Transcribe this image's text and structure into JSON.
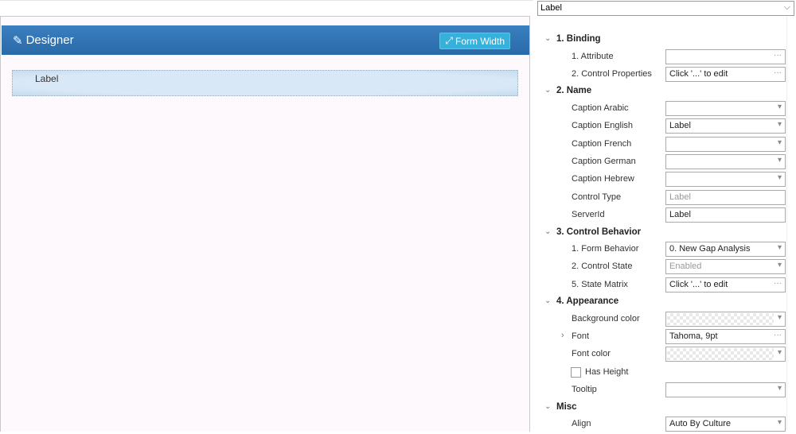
{
  "designer": {
    "title": "Designer",
    "form_width": "Form Width",
    "label_text": "Label"
  },
  "selector": {
    "value": "Label"
  },
  "sections": [
    {
      "title": "1. Binding",
      "rows": [
        {
          "label": "1. Attribute",
          "value": "",
          "kind": "ellipsis"
        },
        {
          "label": "2. Control Properties",
          "value": "Click '...' to edit",
          "kind": "ellipsis"
        }
      ]
    },
    {
      "title": "2. Name",
      "rows": [
        {
          "label": "Caption Arabic",
          "value": "",
          "kind": "dropdown"
        },
        {
          "label": "Caption English",
          "value": "Label",
          "kind": "dropdown"
        },
        {
          "label": "Caption French",
          "value": "",
          "kind": "dropdown"
        },
        {
          "label": "Caption German",
          "value": "",
          "kind": "dropdown"
        },
        {
          "label": "Caption Hebrew",
          "value": "",
          "kind": "dropdown"
        },
        {
          "label": "Control Type",
          "value": "Label",
          "kind": "readonly"
        },
        {
          "label": "ServerId",
          "value": "Label",
          "kind": "text"
        }
      ]
    },
    {
      "title": "3. Control Behavior",
      "rows": [
        {
          "label": "1. Form Behavior",
          "value": "0. New Gap Analysis",
          "kind": "dropdown"
        },
        {
          "label": "2. Control State",
          "value": "Enabled",
          "kind": "dropdown-disabled"
        },
        {
          "label": "5. State Matrix",
          "value": "Click '...' to edit",
          "kind": "ellipsis"
        }
      ]
    },
    {
      "title": "4. Appearance",
      "rows": [
        {
          "label": "Background color",
          "value": "",
          "kind": "color"
        },
        {
          "label": "Font",
          "value": "Tahoma, 9pt",
          "kind": "ellipsis",
          "expandable": true
        },
        {
          "label": "Font color",
          "value": "",
          "kind": "color"
        },
        {
          "label": "Has Height",
          "value": "",
          "kind": "checkbox",
          "checked": false
        },
        {
          "label": "Tooltip",
          "value": "",
          "kind": "dropdown"
        }
      ]
    },
    {
      "title": "Misc",
      "rows": [
        {
          "label": "Align",
          "value": "Auto By Culture",
          "kind": "dropdown"
        }
      ]
    }
  ]
}
